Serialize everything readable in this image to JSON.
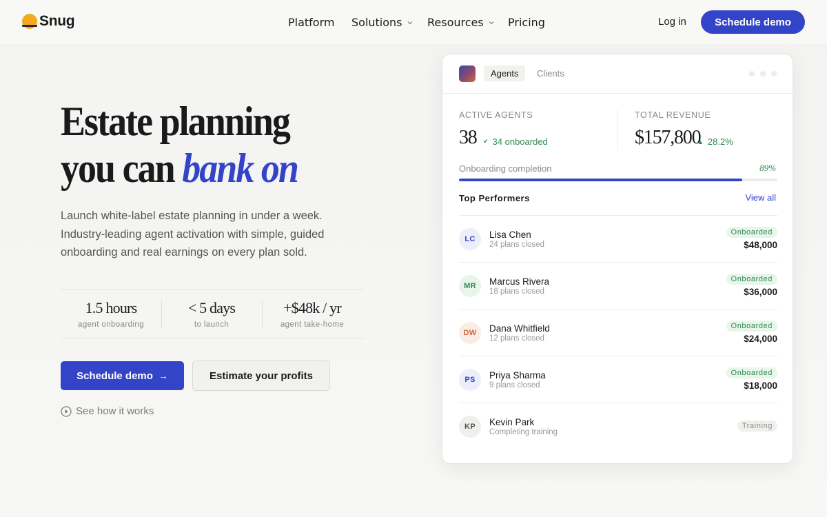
{
  "brand": {
    "name": "Snug"
  },
  "nav": {
    "items": [
      {
        "label": "Platform"
      },
      {
        "label": "Solutions"
      },
      {
        "label": "Resources"
      },
      {
        "label": "Pricing"
      }
    ],
    "login": "Log in",
    "cta": "Schedule demo"
  },
  "hero": {
    "headline_line1": "Estate planning",
    "headline_line2_plain": "you can ",
    "headline_line2_accent": "bank on",
    "lede": "Launch white-label estate planning in under a week. Industry-leading agent activation with simple, guided onboarding and real earnings on every plan sold.",
    "stats": [
      {
        "value": "1.5 hours",
        "label": "agent onboarding"
      },
      {
        "value": "< 5 days",
        "label": "to launch"
      },
      {
        "value": "+$48k / yr",
        "label": "agent take-home"
      }
    ],
    "primary_cta": "Schedule demo",
    "secondary_cta": "Estimate your profits",
    "see_how": "See how it works"
  },
  "dashboard": {
    "tabs": [
      {
        "label": "Agents"
      },
      {
        "label": "Clients"
      }
    ],
    "active_tab": "Agents",
    "metrics": {
      "active_agents_label": "ACTIVE AGENTS",
      "active_agents_value": "38",
      "active_agents_sub": "34 onboarded",
      "revenue_label": "TOTAL REVENUE",
      "revenue_value": "$157,800",
      "revenue_sub": "28.2%"
    },
    "onboarding": {
      "label": "Onboarding completion",
      "percent_text": "89%",
      "fraction": 0.89
    },
    "top_performers_title": "Top Performers",
    "view_all": "View all",
    "performers": [
      {
        "initials": "LC",
        "name": "Lisa Chen",
        "detail": "24 plans closed",
        "status": "Onboarded",
        "amount": "$48,000",
        "avatar_bg": "#eceefb",
        "avatar_fg": "#3444c9"
      },
      {
        "initials": "MR",
        "name": "Marcus Rivera",
        "detail": "18 plans closed",
        "status": "Onboarded",
        "amount": "$36,000",
        "avatar_bg": "#e8f5ea",
        "avatar_fg": "#2e8a4e"
      },
      {
        "initials": "DW",
        "name": "Dana Whitfield",
        "detail": "12 plans closed",
        "status": "Onboarded",
        "amount": "$24,000",
        "avatar_bg": "#fbece6",
        "avatar_fg": "#d0673e"
      },
      {
        "initials": "PS",
        "name": "Priya Sharma",
        "detail": "9 plans closed",
        "status": "Onboarded",
        "amount": "$18,000",
        "avatar_bg": "#eceefb",
        "avatar_fg": "#3444c9"
      },
      {
        "initials": "KP",
        "name": "Kevin Park",
        "detail": "Completing training",
        "status": "Training",
        "amount": "",
        "avatar_bg": "#efefec",
        "avatar_fg": "#555555"
      }
    ]
  },
  "colors": {
    "accent": "#3444c9",
    "success": "#2e8a4e",
    "brand_sun": "#f4a81d"
  },
  "icons": {
    "dropdown": "chevron-down-icon",
    "arrow": "arrow-right-icon",
    "play": "play-circle-icon",
    "check": "check-icon",
    "up": "triangle-up-icon"
  }
}
